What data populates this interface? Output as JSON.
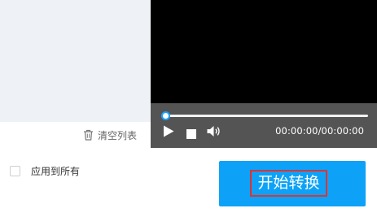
{
  "file_panel": {
    "clear_list_label": "清空列表"
  },
  "player": {
    "progress": 0,
    "time_display": "00:00:00/00:00:00"
  },
  "options": {
    "apply_to_all_label": "应用到所有",
    "apply_to_all_checked": false
  },
  "actions": {
    "start_label": "开始转换"
  },
  "icons": {
    "clear": "trash-icon",
    "play": "play-icon",
    "stop": "stop-icon",
    "volume": "volume-icon"
  },
  "colors": {
    "accent": "#0da2f7",
    "highlight_box": "#e03232",
    "controls_bg": "#545454",
    "video_bg": "#000000",
    "list_bg": "#eef2f6"
  }
}
